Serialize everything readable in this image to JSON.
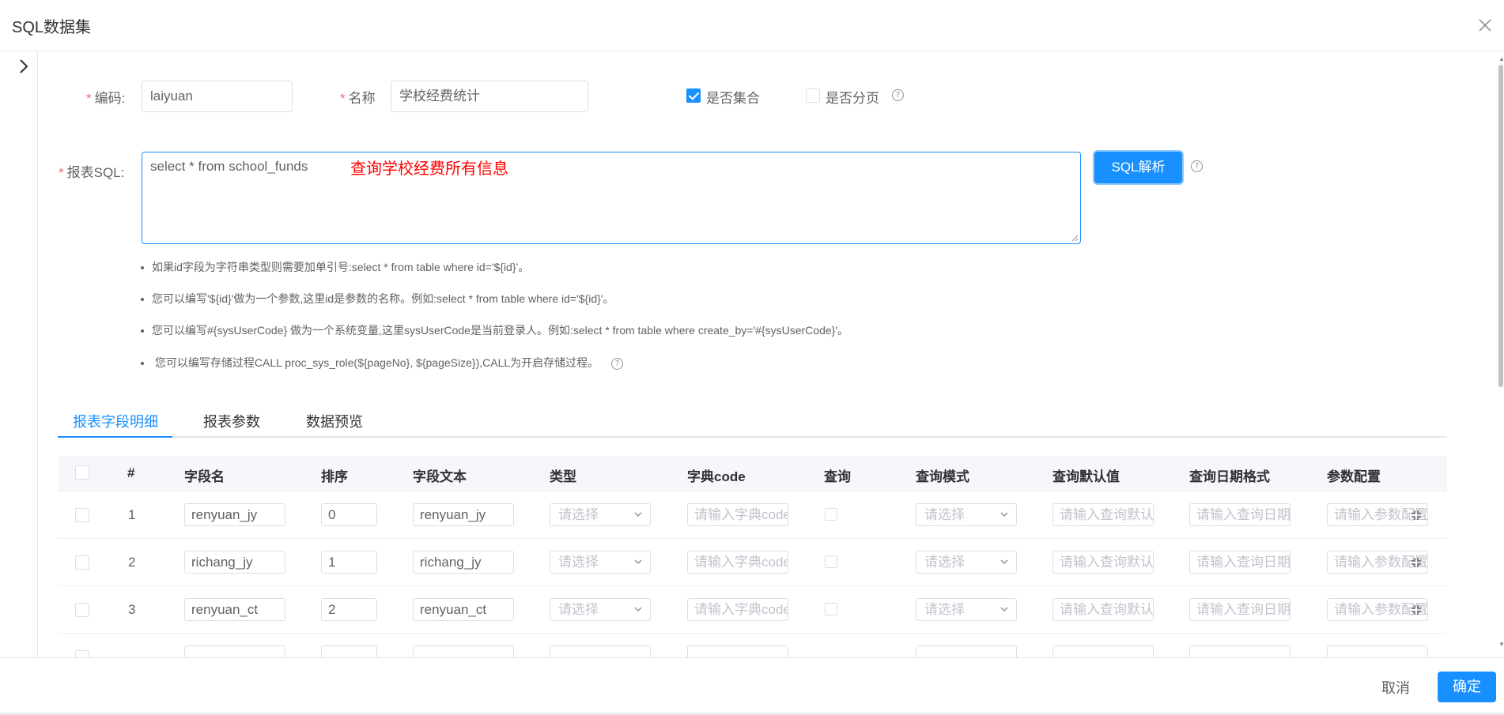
{
  "dialog": {
    "title": "SQL数据集",
    "close_icon": "close-icon"
  },
  "form": {
    "code_label": "编码:",
    "code_value": "laiyuan",
    "name_label": "名称",
    "name_value": "学校经费统计",
    "is_collection_label": "是否集合",
    "is_collection_checked": true,
    "is_paging_label": "是否分页",
    "is_paging_checked": false,
    "sql_label": "报表SQL:",
    "sql_value": "select * from school_funds",
    "sql_note": "查询学校经费所有信息",
    "parse_button": "SQL解析",
    "required_mark": "*",
    "help_mark": "?"
  },
  "tips": [
    "如果id字段为字符串类型则需要加单引号:select * from table where id='${id}'。",
    "您可以编写'${id}'做为一个参数,这里id是参数的名称。例如:select * from table where id='${id}'。",
    "您可以编写#{sysUserCode} 做为一个系统变量,这里sysUserCode是当前登录人。例如:select * from table where create_by='#{sysUserCode}'。",
    "您可以编写存储过程CALL proc_sys_role(${pageNo}, ${pageSize}),CALL为开启存储过程。"
  ],
  "tabs": [
    "报表字段明细",
    "报表参数",
    "数据预览"
  ],
  "table": {
    "headers": [
      "#",
      "字段名",
      "排序",
      "字段文本",
      "类型",
      "字典code",
      "查询",
      "查询模式",
      "查询默认值",
      "查询日期格式",
      "参数配置"
    ],
    "placeholders": {
      "type": "请选择",
      "dict_code": "请输入字典code",
      "query_mode": "请选择",
      "default_value": "请输入查询默认值",
      "date_format": "请输入查询日期格式",
      "param_config": "请输入参数配置"
    },
    "rows": [
      {
        "index": "1",
        "field_name": "renyuan_jy",
        "order": "0",
        "field_text": "renyuan_jy"
      },
      {
        "index": "2",
        "field_name": "richang_jy",
        "order": "1",
        "field_text": "richang_jy"
      },
      {
        "index": "3",
        "field_name": "renyuan_ct",
        "order": "2",
        "field_text": "renyuan_ct"
      }
    ]
  },
  "footer": {
    "cancel": "取消",
    "ok": "确定"
  },
  "colors": {
    "primary": "#1890ff",
    "required": "#f56c6c",
    "note": "#ff0000"
  }
}
